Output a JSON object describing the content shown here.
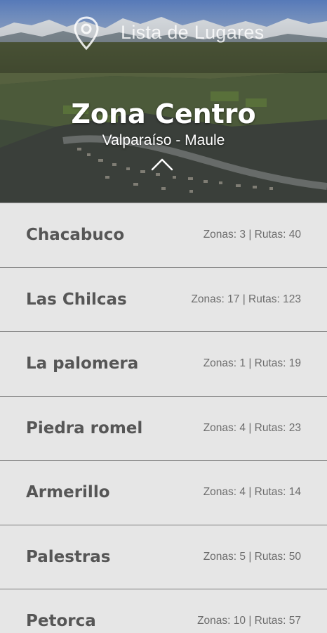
{
  "header": {
    "app_title": "Lista de Lugares",
    "zone_title": "Zona Centro",
    "zone_subtitle": "Valparaíso - Maule",
    "icons": {
      "pin": "location-pin-icon",
      "collapse": "chevron-up-icon"
    }
  },
  "places": [
    {
      "name": "Chacabuco",
      "stats": "Zonas: 3 | Rutas: 40"
    },
    {
      "name": "Las Chilcas",
      "stats": "Zonas: 17 | Rutas: 123"
    },
    {
      "name": "La palomera",
      "stats": "Zonas: 1 | Rutas: 19"
    },
    {
      "name": "Piedra romel",
      "stats": "Zonas: 4 | Rutas: 23"
    },
    {
      "name": "Armerillo",
      "stats": "Zonas: 4 | Rutas: 14"
    },
    {
      "name": "Palestras",
      "stats": "Zonas: 5 | Rutas: 50"
    },
    {
      "name": "Petorca",
      "stats": "Zonas: 10 | Rutas: 57"
    }
  ],
  "colors": {
    "list_bg": "#e6e6e6",
    "divider": "#7d7d7d",
    "name_text": "#565656",
    "stats_text": "#6d6d6d"
  }
}
